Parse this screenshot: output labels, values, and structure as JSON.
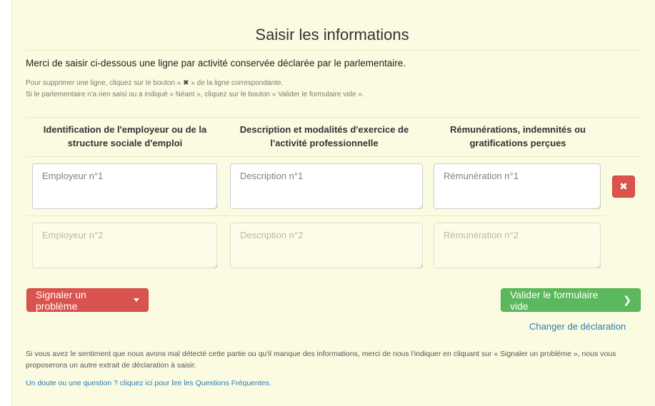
{
  "form": {
    "title": "Saisir les informations",
    "intro": "Merci de saisir ci-dessous une ligne par activité conservée déclarée par le parlementaire.",
    "hint1_before": "Pour supprimer une ligne, cliquez sur le bouton «",
    "hint1_icon": "✖",
    "hint1_after": "» de la ligne correspondante.",
    "hint2": "Si le parlementaire n'a rien saisi ou a indiqué « Néant », cliquez sur le bouton « Valider le formulaire vide ».",
    "columns": [
      "Identification de l'employeur ou de la structure sociale d'emploi",
      "Description et modalités d'exercice de l'activité professionnelle",
      "Rémunérations, indemnités ou gratifications perçues"
    ],
    "rows": [
      {
        "employer_placeholder": "Employeur n°1",
        "description_placeholder": "Description n°1",
        "remuneration_placeholder": "Rémunération n°1",
        "delete_icon": "close-icon"
      },
      {
        "employer_placeholder": "Employeur n°2",
        "description_placeholder": "Description n°2",
        "remuneration_placeholder": "Rémunération n°2"
      }
    ],
    "report_button": "Signaler un problème",
    "validate_button": "Valider le formulaire vide",
    "change_link": "Changer de déclaration",
    "footer_text": "Si vous avez le sentiment que nous avons mal détecté cette partie ou qu'il manque des informations, merci de nous l'indiquer en cliquant sur « Signaler un problème », nous vous proposerons un autre extrait de déclaration à saisir.",
    "faq_link": "Un doute ou une question ? cliquez ici pour lire les Questions Fréquentes."
  },
  "colors": {
    "panel_bg": "#fbfbe2",
    "danger": "#d9534f",
    "success": "#5cb85c",
    "link": "#2a7ab0"
  }
}
